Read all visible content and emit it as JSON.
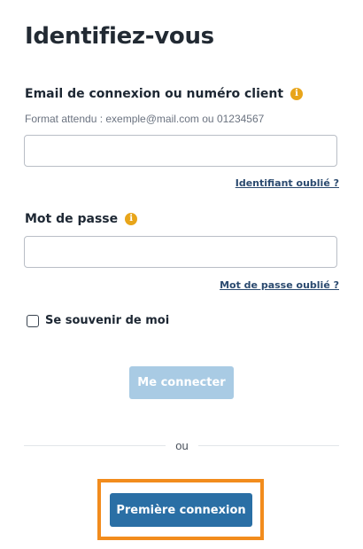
{
  "page": {
    "title": "Identifiez-vous"
  },
  "login_field": {
    "label": "Email de connexion ou numéro client",
    "hint": "Format attendu : exemple@mail.com ou 01234567",
    "value": "",
    "info_icon": "info-icon",
    "forgot_link": "Identifiant oublié ?"
  },
  "password_field": {
    "label": "Mot de passe",
    "value": "",
    "info_icon": "info-icon",
    "forgot_link": "Mot de passe oublié ?"
  },
  "remember": {
    "label": "Se souvenir de moi",
    "checked": false
  },
  "actions": {
    "connect_label": "Me connecter",
    "separator_label": "ou",
    "first_login_label": "Première connexion"
  },
  "colors": {
    "info_icon": "#e8a51a",
    "connect_button_disabled": "#a9cbe4",
    "first_login_button": "#2a6fa5",
    "highlight_border": "#f28c1d",
    "link": "#2b4a6f"
  }
}
